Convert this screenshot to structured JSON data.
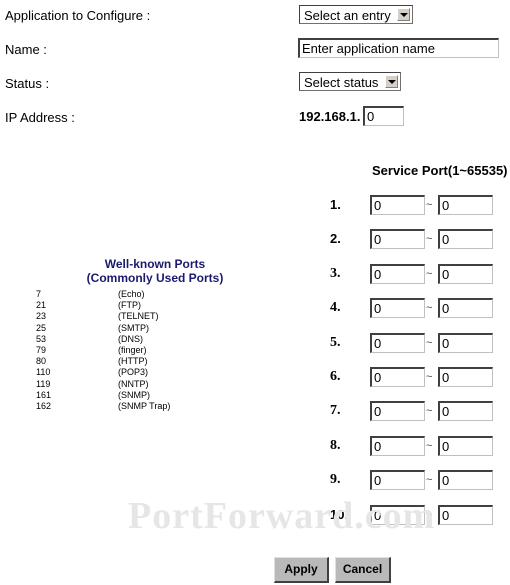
{
  "form": {
    "app_label": "Application to Configure :",
    "app_select_value": "Select an entry",
    "name_label": "Name :",
    "name_value": "Enter application name",
    "status_label": "Status :",
    "status_select_value": "Select status",
    "ip_label": "IP Address :",
    "ip_prefix": "192.168.1.",
    "ip_last_octet": "0"
  },
  "service_ports": {
    "title": "Service Port(1~65535)",
    "separator": "~",
    "rows": [
      {
        "index": "1.",
        "from": "0",
        "to": "0"
      },
      {
        "index": "2.",
        "from": "0",
        "to": "0"
      },
      {
        "index": "3.",
        "from": "0",
        "to": "0"
      },
      {
        "index": "4.",
        "from": "0",
        "to": "0"
      },
      {
        "index": "5.",
        "from": "0",
        "to": "0"
      },
      {
        "index": "6.",
        "from": "0",
        "to": "0"
      },
      {
        "index": "7.",
        "from": "0",
        "to": "0"
      },
      {
        "index": "8.",
        "from": "0",
        "to": "0"
      },
      {
        "index": "9.",
        "from": "0",
        "to": "0"
      },
      {
        "index": "10.",
        "from": "0",
        "to": "0"
      }
    ]
  },
  "well_known": {
    "title_line1": "Well-known Ports",
    "title_line2": "(Commonly Used Ports)",
    "ports": [
      {
        "port": "7",
        "service": "(Echo)"
      },
      {
        "port": "21",
        "service": "(FTP)"
      },
      {
        "port": "23",
        "service": "(TELNET)"
      },
      {
        "port": "25",
        "service": "(SMTP)"
      },
      {
        "port": "53",
        "service": "(DNS)"
      },
      {
        "port": "79",
        "service": "(finger)"
      },
      {
        "port": "80",
        "service": "(HTTP)"
      },
      {
        "port": "110",
        "service": "(POP3)"
      },
      {
        "port": "119",
        "service": "(NNTP)"
      },
      {
        "port": "161",
        "service": "(SNMP)"
      },
      {
        "port": "162",
        "service": "(SNMP Trap)"
      }
    ]
  },
  "watermark": "PortForward.com",
  "buttons": {
    "apply": "Apply",
    "cancel": "Cancel"
  }
}
